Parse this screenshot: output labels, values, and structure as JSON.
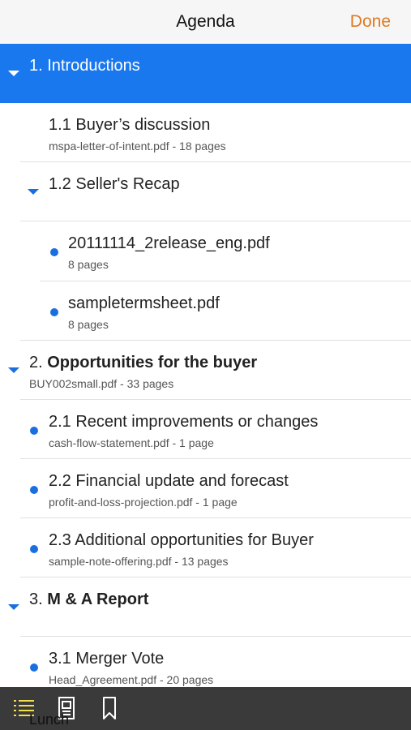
{
  "nav": {
    "title": "Agenda",
    "done_label": "Done"
  },
  "rows": [
    {
      "num": "1. ",
      "title": "Introductions",
      "sub": ""
    },
    {
      "num": "",
      "title": "1.1 Buyer’s discussion",
      "sub": "mspa-letter-of-intent.pdf - 18 pages"
    },
    {
      "num": "",
      "title": "1.2 Seller's Recap",
      "sub": ""
    },
    {
      "num": "",
      "title": "20111114_2release_eng.pdf",
      "sub": "8 pages"
    },
    {
      "num": "",
      "title": "sampletermsheet.pdf",
      "sub": "8 pages"
    },
    {
      "num": "2. ",
      "title": "Opportunities for the buyer",
      "sub": "BUY002small.pdf - 33 pages"
    },
    {
      "num": "",
      "title": "2.1 Recent improvements or changes",
      "sub": "cash-flow-statement.pdf - 1 page"
    },
    {
      "num": "",
      "title": "2.2 Financial update and forecast",
      "sub": "profit-and-loss-projection.pdf - 1 page"
    },
    {
      "num": "",
      "title": "2.3 Additional opportunities for Buyer",
      "sub": "sample-note-offering.pdf - 13 pages"
    },
    {
      "num": "3. ",
      "title": "M & A Report",
      "sub": ""
    },
    {
      "num": "",
      "title": "3.1 Merger Vote",
      "sub": "Head_Agreement.pdf - 20 pages"
    }
  ],
  "peek_label": "Lunch",
  "tabbar": {
    "tabs": [
      "list-icon",
      "document-icon",
      "bookmark-icon"
    ],
    "active_color": "#f1e04a"
  },
  "colors": {
    "accent": "#1a78ee",
    "done": "#e07a1f"
  }
}
